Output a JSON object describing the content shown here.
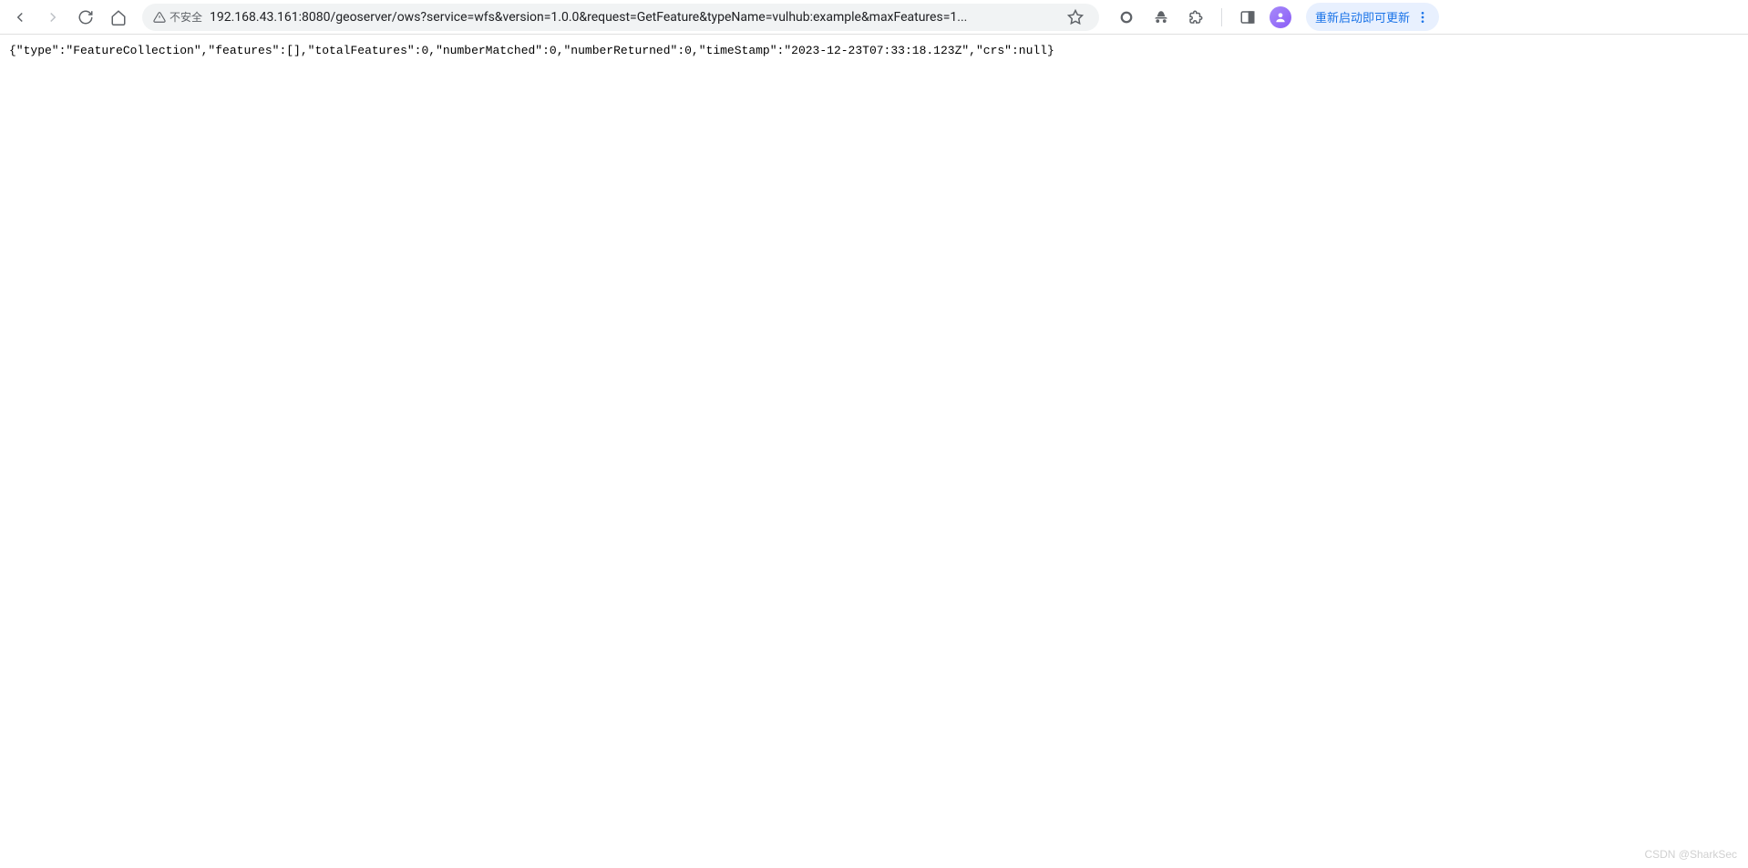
{
  "toolbar": {
    "security_label": "不安全",
    "url_display": "192.168.43.161:8080/geoserver/ows?service=wfs&version=1.0.0&request=GetFeature&typeName=vulhub:example&maxFeatures=1...",
    "update_label": "重新启动即可更新"
  },
  "page": {
    "body_text": "{\"type\":\"FeatureCollection\",\"features\":[],\"totalFeatures\":0,\"numberMatched\":0,\"numberReturned\":0,\"timeStamp\":\"2023-12-23T07:33:18.123Z\",\"crs\":null}"
  },
  "watermark": {
    "text": "CSDN @SharkSec"
  }
}
